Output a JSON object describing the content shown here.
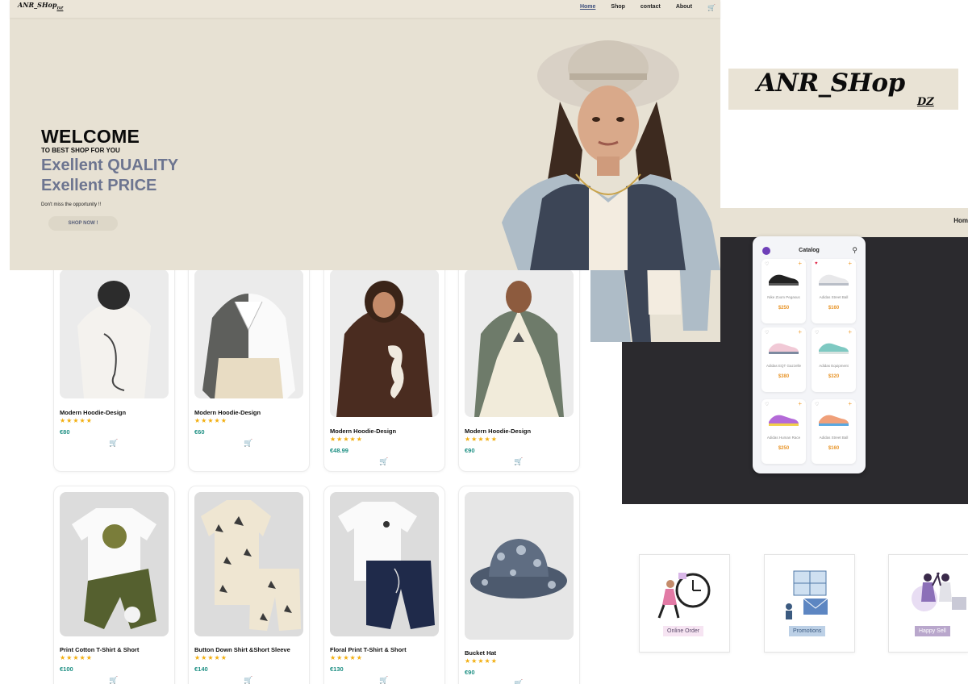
{
  "navbar": {
    "logo": "ANR_SHop",
    "logo_sub": "DZ",
    "links": [
      "Home",
      "Shop",
      "contact",
      "About"
    ],
    "active": "Home",
    "cart_icon": "cart-icon"
  },
  "hero": {
    "welcome": "WELCOME",
    "tagline": "TO BEST SHOP FOR YOU",
    "line1": "Exellent QUALITY",
    "line2": "Exellent PRICE",
    "note": "Don't miss the opportunity !!",
    "cta": "SHOP NOW !"
  },
  "products": [
    {
      "title": "Modern Hoodie-Design",
      "stars": "★★★★★",
      "price": "€80"
    },
    {
      "title": "Modern Hoodie-Design",
      "stars": "★★★★★",
      "price": "€60"
    },
    {
      "title": "Modern Hoodie-Design",
      "stars": "★★★★★",
      "price": "€48.99"
    },
    {
      "title": "Modern Hoodie-Design",
      "stars": "★★★★★",
      "price": "€90"
    },
    {
      "title": "Print Cotton T-Shirt & Short",
      "stars": "★★★★★",
      "price": "€100"
    },
    {
      "title": "Button Down Shirt &Short Sleeve",
      "stars": "★★★★★",
      "price": "€140"
    },
    {
      "title": "Floral Print T-Shirt & Short",
      "stars": "★★★★★",
      "price": "€130"
    },
    {
      "title": "Bucket Hat",
      "stars": "★★★★★",
      "price": "€90"
    }
  ],
  "logo_panel": {
    "text": "ANR_SHop",
    "sub": "DZ"
  },
  "second_nav": {
    "label": "Hom"
  },
  "catalog": {
    "title": "Catalog",
    "items": [
      {
        "name": "Nike Zoom Pegasus",
        "price": "$250",
        "liked": false
      },
      {
        "name": "Adidas Street Ball",
        "price": "$160",
        "liked": true
      },
      {
        "name": "Adidas EQT Gazzelle",
        "price": "$380",
        "liked": false
      },
      {
        "name": "Adidas Equipment",
        "price": "$320",
        "liked": false
      },
      {
        "name": "Adidas Human Race",
        "price": "$250",
        "liked": false
      },
      {
        "name": "Adidas Street Ball",
        "price": "$160",
        "liked": false
      }
    ]
  },
  "features": [
    {
      "label": "Online Order",
      "bg": "#f6e4f2",
      "color": "#5a4a6a"
    },
    {
      "label": "Promotions",
      "bg": "#bcd0e6",
      "color": "#3b5a80"
    },
    {
      "label": "Happy Sell",
      "bg": "#b9a7cc",
      "color": "#ffffff"
    }
  ]
}
